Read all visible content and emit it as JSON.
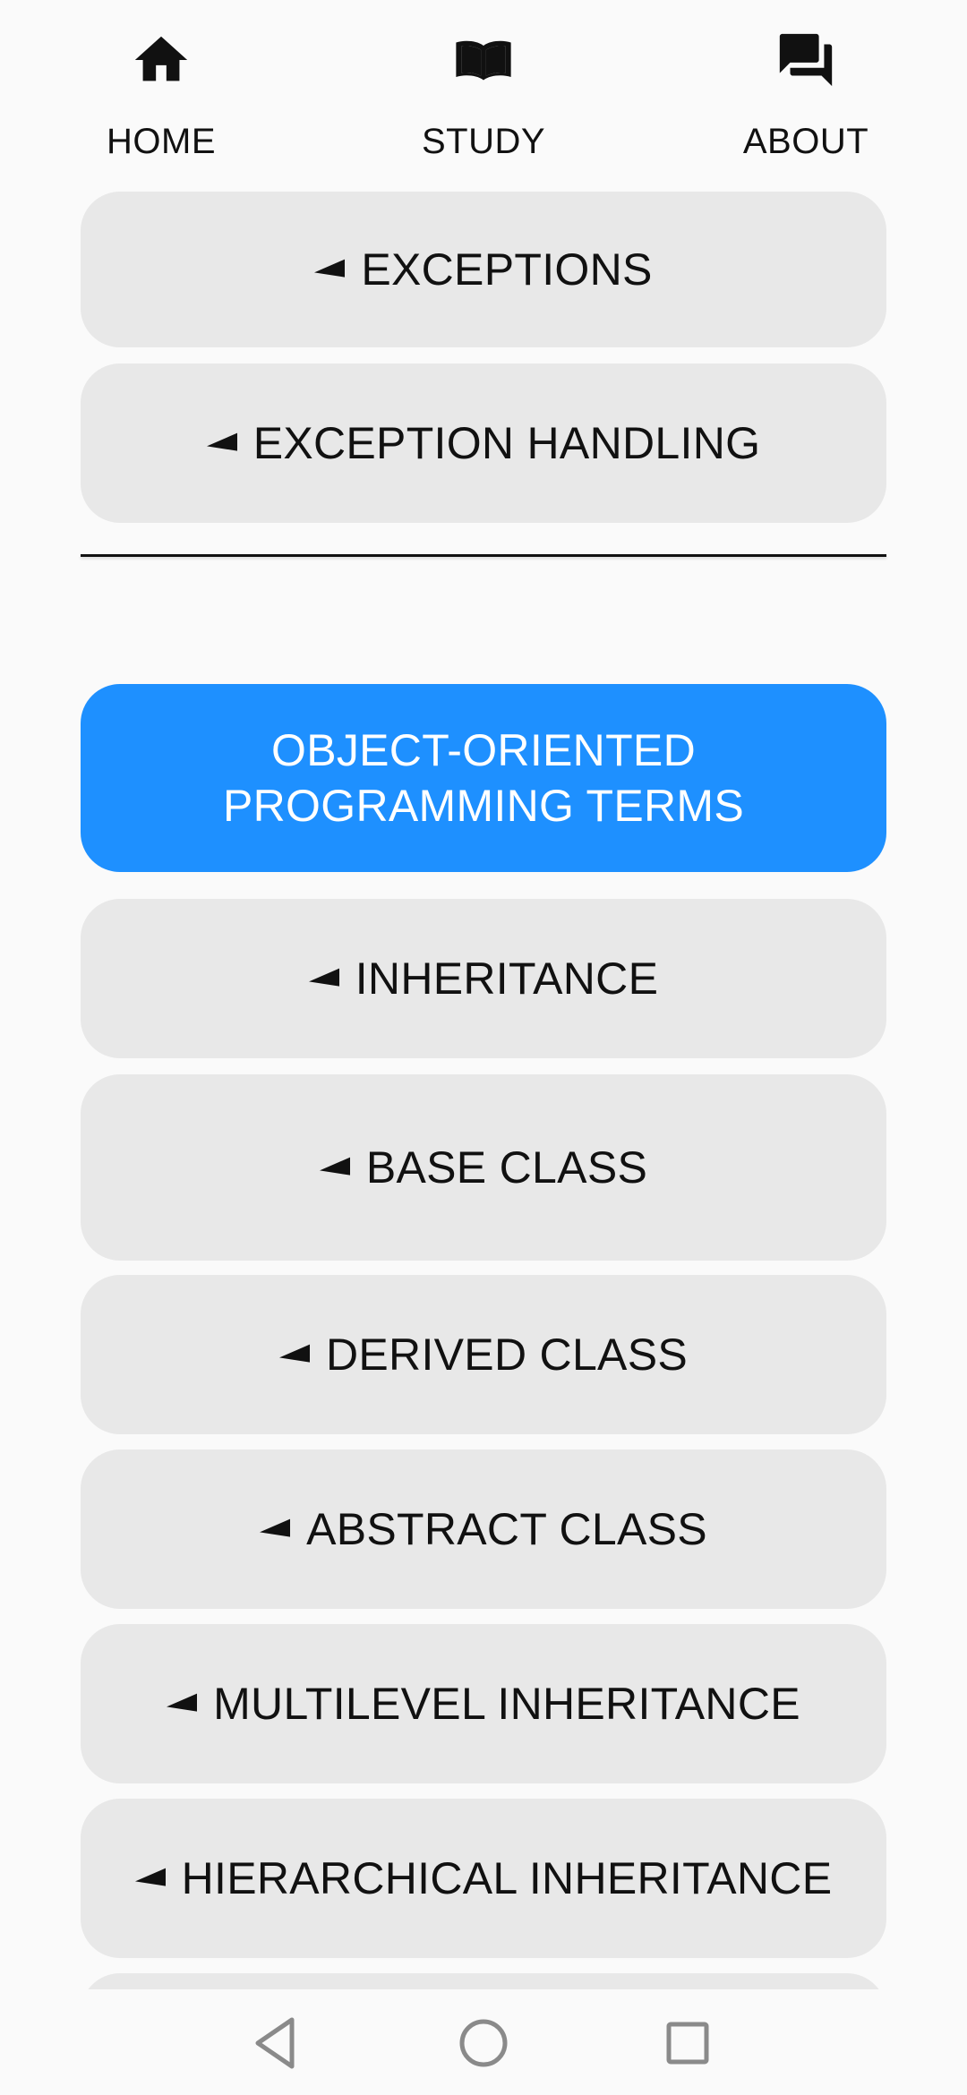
{
  "tabs": [
    {
      "label": "HOME",
      "icon": "home-icon"
    },
    {
      "label": "STUDY",
      "icon": "book-icon"
    },
    {
      "label": "ABOUT",
      "icon": "forum-icon"
    }
  ],
  "items_above": [
    {
      "label": "EXCEPTIONS"
    },
    {
      "label": "EXCEPTION HANDLING"
    }
  ],
  "section": {
    "line1": "OBJECT-ORIENTED",
    "line2": "PROGRAMMING TERMS"
  },
  "items_below": [
    {
      "label": "INHERITANCE"
    },
    {
      "label": "BASE CLASS"
    },
    {
      "label": "DERIVED CLASS"
    },
    {
      "label": "ABSTRACT CLASS"
    },
    {
      "label": "MULTILEVEL INHERITANCE"
    },
    {
      "label": "HIERARCHICAL INHERITANCE"
    }
  ],
  "system_nav": {
    "back": "back-icon",
    "home": "home-circle-icon",
    "recent": "recent-apps-icon"
  },
  "colors": {
    "accent": "#1e90ff",
    "item_bg": "#e8e8e8",
    "background": "#fafafa"
  }
}
